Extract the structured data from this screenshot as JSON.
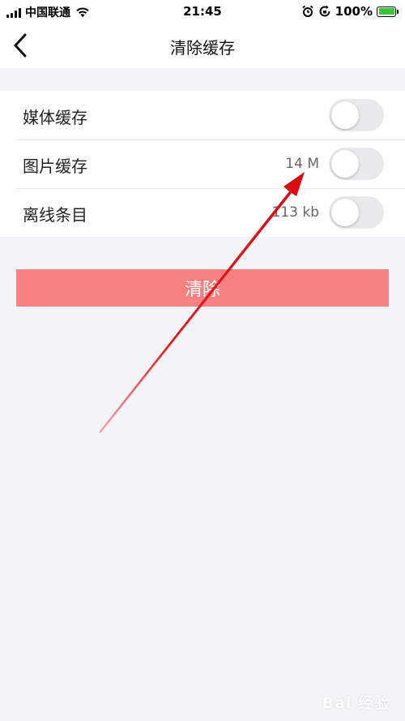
{
  "status_bar": {
    "carrier": "中国联通",
    "time": "21:45",
    "battery": "100%"
  },
  "nav": {
    "title": "清除缓存",
    "back_icon": "chevron-left-icon"
  },
  "cache_items": [
    {
      "label": "媒体缓存",
      "size": "",
      "toggle_on": false
    },
    {
      "label": "图片缓存",
      "size": "14 M",
      "toggle_on": false
    },
    {
      "label": "离线条目",
      "size": "113 kb",
      "toggle_on": false
    }
  ],
  "clear_button": {
    "label": "清除"
  },
  "colors": {
    "clear_button_bg": "#f78080",
    "annotation_arrow": "#e8161b",
    "page_bg": "#f4f4f8"
  },
  "watermark": "Bai 经验"
}
